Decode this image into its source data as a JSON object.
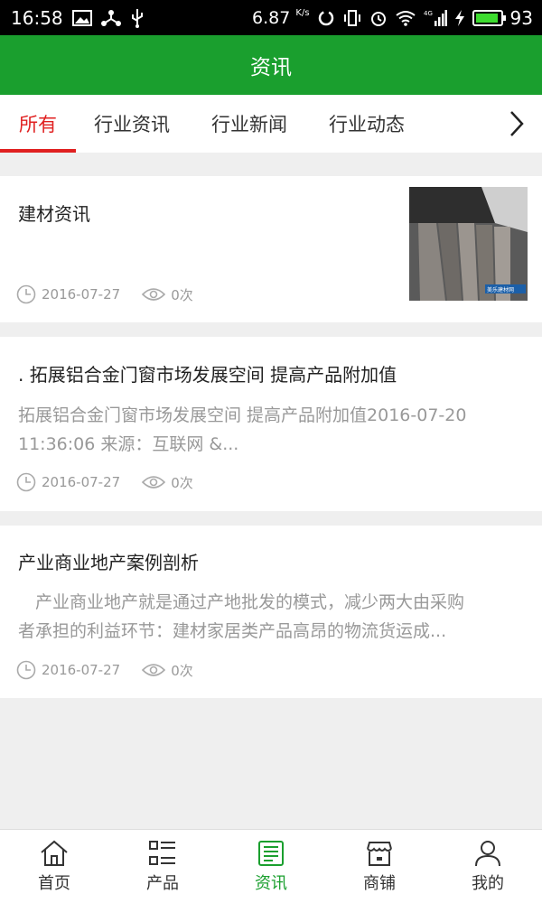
{
  "status_bar": {
    "time": "16:58",
    "speed": "6.87",
    "speed_unit": "K/s",
    "network": "4G",
    "battery": "93",
    "battery_level": 0.93
  },
  "header": {
    "title": "资讯"
  },
  "tabs": [
    {
      "label": "所有",
      "active": true
    },
    {
      "label": "行业资讯"
    },
    {
      "label": "行业新闻"
    },
    {
      "label": "行业动态"
    }
  ],
  "articles": [
    {
      "title": "建材资讯",
      "summary": "",
      "date": "2016-07-27",
      "views": "0次",
      "thumbnail_caption": "美乐建材网"
    },
    {
      "title": ". 拓展铝合金门窗市场发展空间 提高产品附加值",
      "summary_line1": "拓展铝合金门窗市场发展空间 提高产品附加值2016-07-20",
      "summary_line2": "11:36:06 来源：互联网 &...",
      "date": "2016-07-27",
      "views": "0次"
    },
    {
      "title": "产业商业地产案例剖析",
      "summary_line1": "　产业商业地产就是通过产地批发的模式，减少两大由采购",
      "summary_line2": "者承担的利益环节：建材家居类产品高昂的物流货运成...",
      "date": "2016-07-27",
      "views": "0次"
    }
  ],
  "bottom_nav": [
    {
      "label": "首页",
      "icon": "home-icon"
    },
    {
      "label": "产品",
      "icon": "grid-list-icon"
    },
    {
      "label": "资讯",
      "icon": "news-icon",
      "active": true
    },
    {
      "label": "商铺",
      "icon": "store-icon"
    },
    {
      "label": "我的",
      "icon": "user-icon"
    }
  ],
  "colors": {
    "primary": "#1a9f2e",
    "accent": "#e02020"
  }
}
